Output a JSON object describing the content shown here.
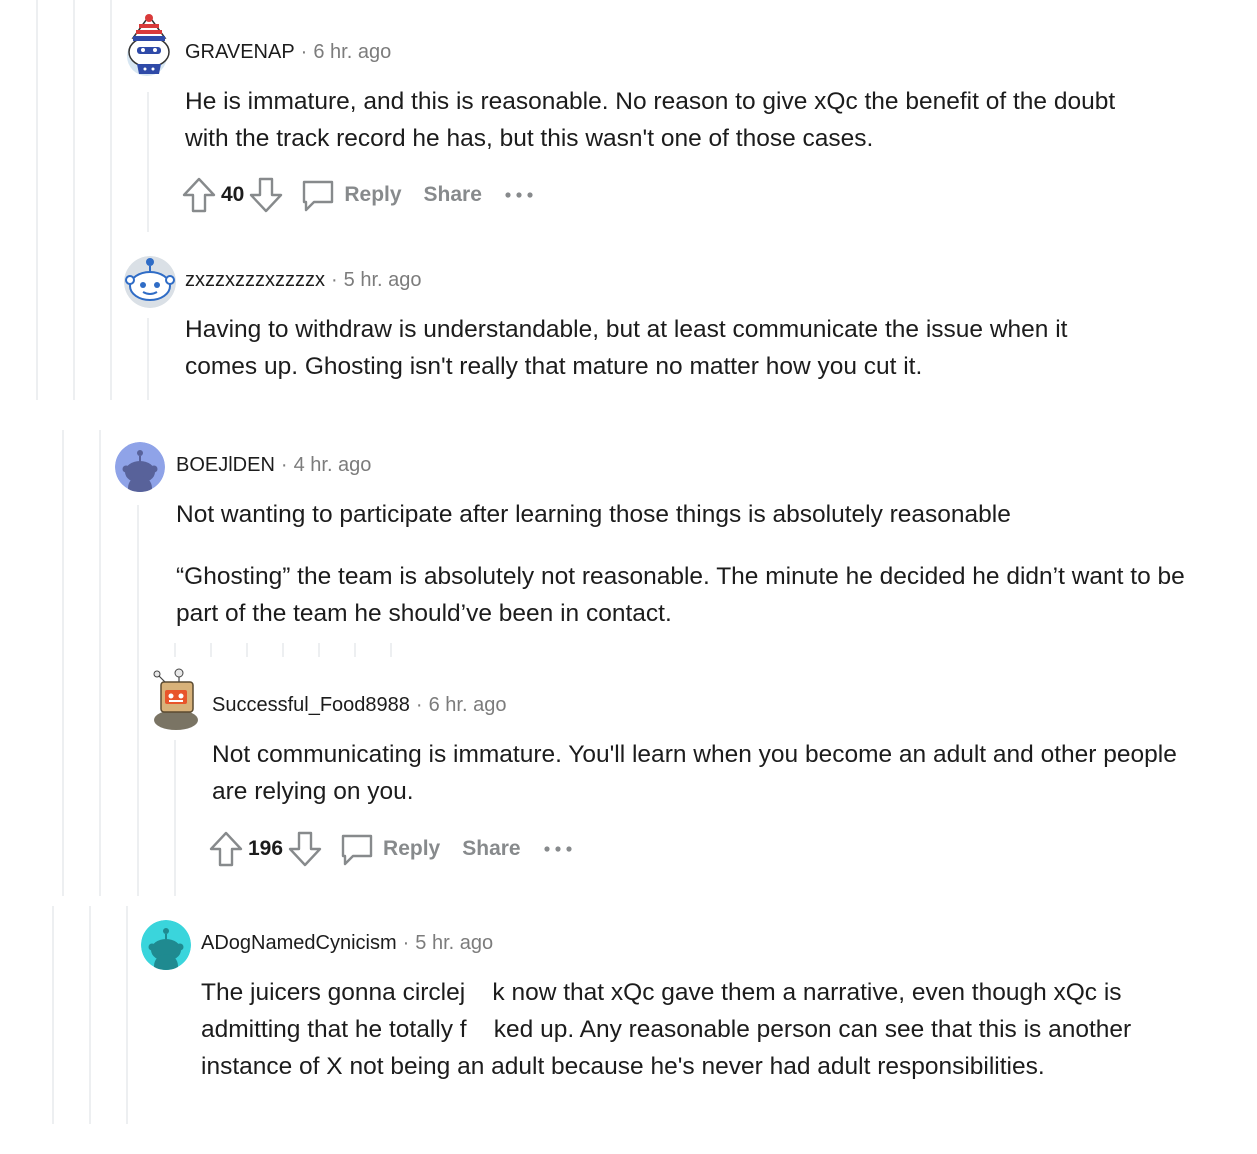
{
  "comments": [
    {
      "author": "GRAVENAP",
      "time": "6 hr. ago",
      "body": [
        "He is immature, and this is reasonable. No reason to give xQc the benefit of the doubt with the track record he has, but this wasn't one of those cases."
      ],
      "score": "40",
      "reply_label": "Reply",
      "share_label": "Share"
    },
    {
      "author": "zxzzxzzzxzzzzx",
      "time": "5 hr. ago",
      "body": [
        "Having to withdraw is understandable, but at least communicate the issue when it comes up. Ghosting isn't really that mature no matter how you cut it."
      ]
    },
    {
      "author": "BOEJlDEN",
      "time": "4 hr. ago",
      "body": [
        "Not wanting to participate after learning those things is absolutely reasonable",
        "“Ghosting” the team is absolutely not reasonable. The minute he decided he didn’t want to be part of the team he should’ve been in contact."
      ]
    },
    {
      "author": "Successful_Food8988",
      "time": "6 hr. ago",
      "body": [
        "Not communicating is immature. You'll learn when you become an adult and other people are relying on you."
      ],
      "score": "196",
      "reply_label": "Reply",
      "share_label": "Share"
    },
    {
      "author": "ADogNamedCynicism",
      "time": "5 hr. ago",
      "body": [
        "The juicers gonna circlej    k now that xQc gave them a narrative, even though xQc is admitting that he totally f    ked up. Any reasonable person can see that this is another instance of X not being an adult because he's never had adult responsibilities."
      ]
    }
  ],
  "separator": "·",
  "colors": {
    "thread_line": "#edeff1",
    "meta_gray": "#7c7c7c",
    "action_gray": "#878a8c",
    "text": "#1c1c1c",
    "avatar_blue": "#8fa3e8",
    "avatar_teal": "#3ad5dc"
  },
  "icons": [
    "upvote-icon",
    "downvote-icon",
    "comment-icon",
    "more-options-icon"
  ]
}
